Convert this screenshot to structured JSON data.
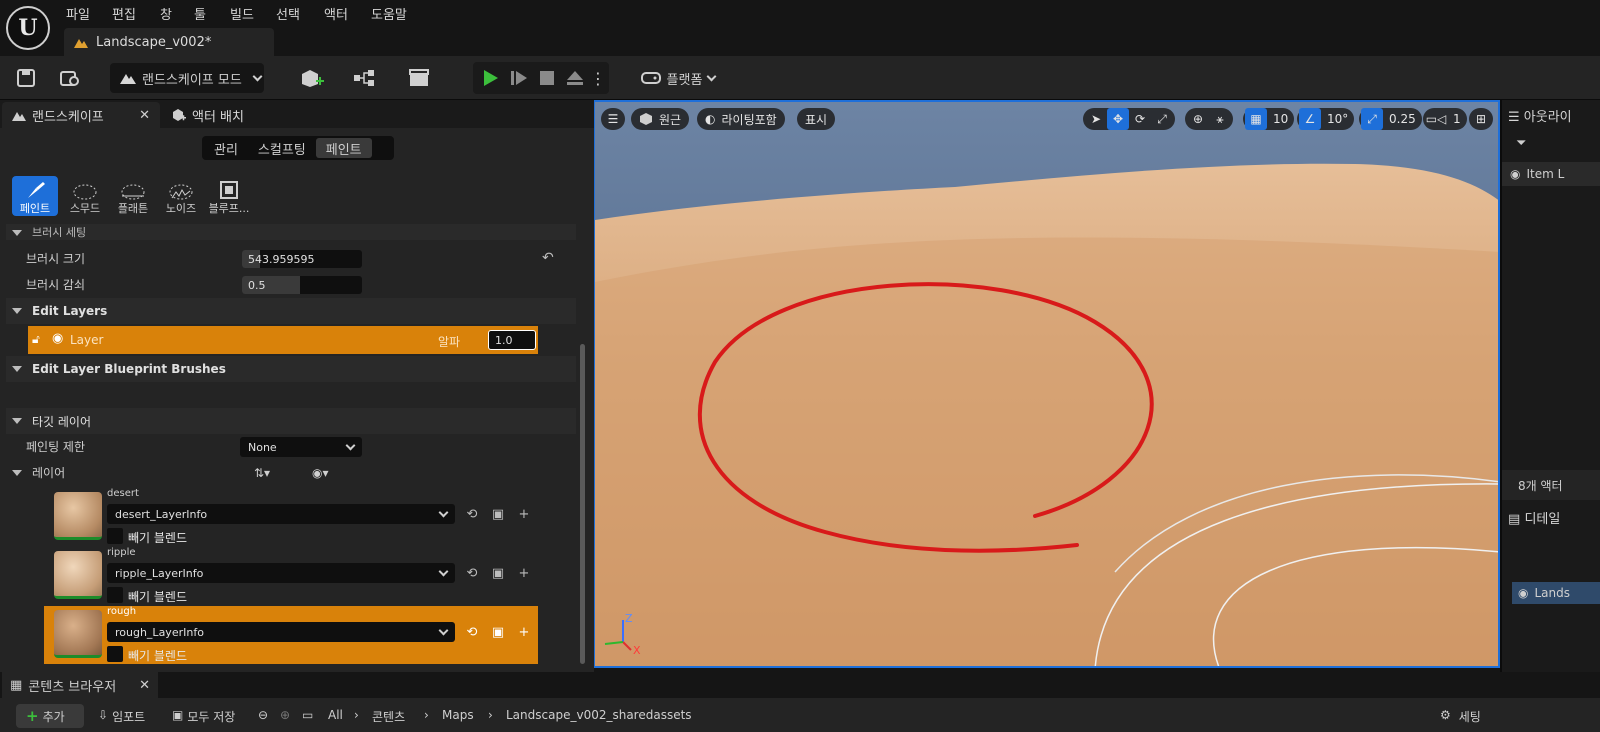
{
  "menu": {
    "items": [
      "파일",
      "편집",
      "창",
      "툴",
      "빌드",
      "선택",
      "액터",
      "도움말"
    ],
    "document_tab": "Landscape_v002*"
  },
  "toolbar": {
    "mode_label": "랜드스케이프 모드",
    "platform_label": "플랫폼"
  },
  "left_panel": {
    "tab_landscape": "랜드스케이프",
    "tab_place_actors": "액터 배치",
    "segments": [
      "관리",
      "스컬프팅",
      "페인트"
    ],
    "active_segment": "페인트",
    "tools": [
      "페인트",
      "스무드",
      "플래튼",
      "노이즈",
      "블루프..."
    ],
    "brush_section": "브러시 세팅",
    "brush_size_label": "브러시 크기",
    "brush_size_value": "543.959595",
    "brush_falloff_label": "브러시 감쇠",
    "brush_falloff_value": "0.5",
    "edit_layers_title": "Edit Layers",
    "layer_name": "Layer",
    "alpha_label": "알파",
    "alpha_value": "1.0",
    "blueprint_brushes_title": "Edit Layer Blueprint Brushes",
    "target_layers_title": "타깃 레이어",
    "paint_restriction_label": "페인팅 제한",
    "paint_restriction_value": "None",
    "layers_label": "레이어",
    "layers": [
      {
        "name": "desert",
        "info": "desert_LayerInfo",
        "blend": "빼기 블렌드",
        "selected": false
      },
      {
        "name": "ripple",
        "info": "ripple_LayerInfo",
        "blend": "빼기 블렌드",
        "selected": false
      },
      {
        "name": "rough",
        "info": "rough_LayerInfo",
        "blend": "빼기 블렌드",
        "selected": true
      }
    ]
  },
  "viewport": {
    "perspective": "원근",
    "lighting": "라이팅포함",
    "show": "표시",
    "grid_snap": "10",
    "rotation_snap": "10°",
    "scale_snap": "0.25",
    "camera_speed": "1",
    "axis_z": "Z",
    "axis_x": "X"
  },
  "right_panel": {
    "outliner_title": "아웃라이",
    "item_label_header": "Item L",
    "actor_count": "8개 액터",
    "details_title": "디테일",
    "details_item": "Lands"
  },
  "bottom": {
    "content_browser_tab": "콘텐츠 브라우저",
    "add_label": "추가",
    "import_label": "임포트",
    "save_all_label": "모두 저장",
    "path": [
      "All",
      "콘텐츠",
      "Maps",
      "Landscape_v002_sharedassets"
    ],
    "settings_label": "세팅"
  },
  "colors": {
    "accent_orange": "#d9820a",
    "accent_blue": "#1e6fd9",
    "sand": "#d3a173",
    "sky": "#5a7394"
  }
}
